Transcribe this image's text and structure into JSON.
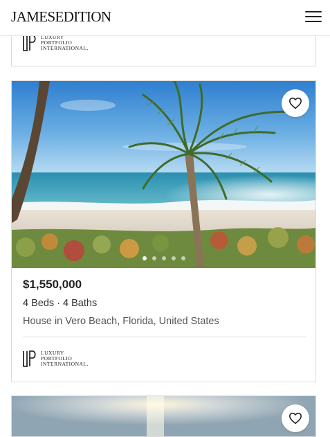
{
  "header": {
    "logo": "JAMESEDITION",
    "menu_icon": "hamburger-menu-icon"
  },
  "broker": {
    "line1": "LUXURY",
    "line2": "PORTFOLIO",
    "line3": "INTERNATIONAL."
  },
  "listing": {
    "price": "$1,550,000",
    "specs": "4 Beds · 4 Baths",
    "location": "House in Vero Beach, Florida, United States",
    "favorite_icon": "heart-icon",
    "carousel_total": 5,
    "carousel_active": 1
  },
  "colors": {
    "brand_text": "#111111",
    "border": "#dcdcdc"
  }
}
